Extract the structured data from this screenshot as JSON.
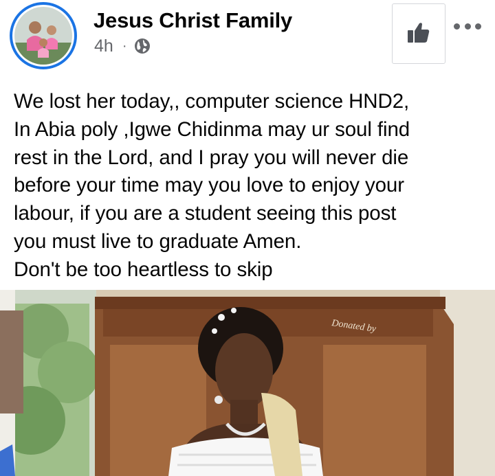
{
  "header": {
    "page_name": "Jesus Christ Family",
    "timestamp": "4h",
    "separator": "·",
    "privacy_icon": "globe-icon",
    "like_icon": "thumbs-up-icon",
    "more_icon": "more-dots-icon"
  },
  "post": {
    "text": "We lost her today,, computer science HND2,\nIn Abia poly ,Igwe Chidinma may ur soul find\nrest in the Lord, and I pray you will never die\nbefore your time may you love to enjoy your\nlabour, if you are a student seeing this post\nyou must live to graduate Amen.\nDon't be too heartless to skip"
  },
  "photo": {
    "podium_inscription": "Donated by"
  },
  "colors": {
    "accent": "#1b74e4",
    "text": "#050505",
    "secondary_text": "#65676b"
  }
}
